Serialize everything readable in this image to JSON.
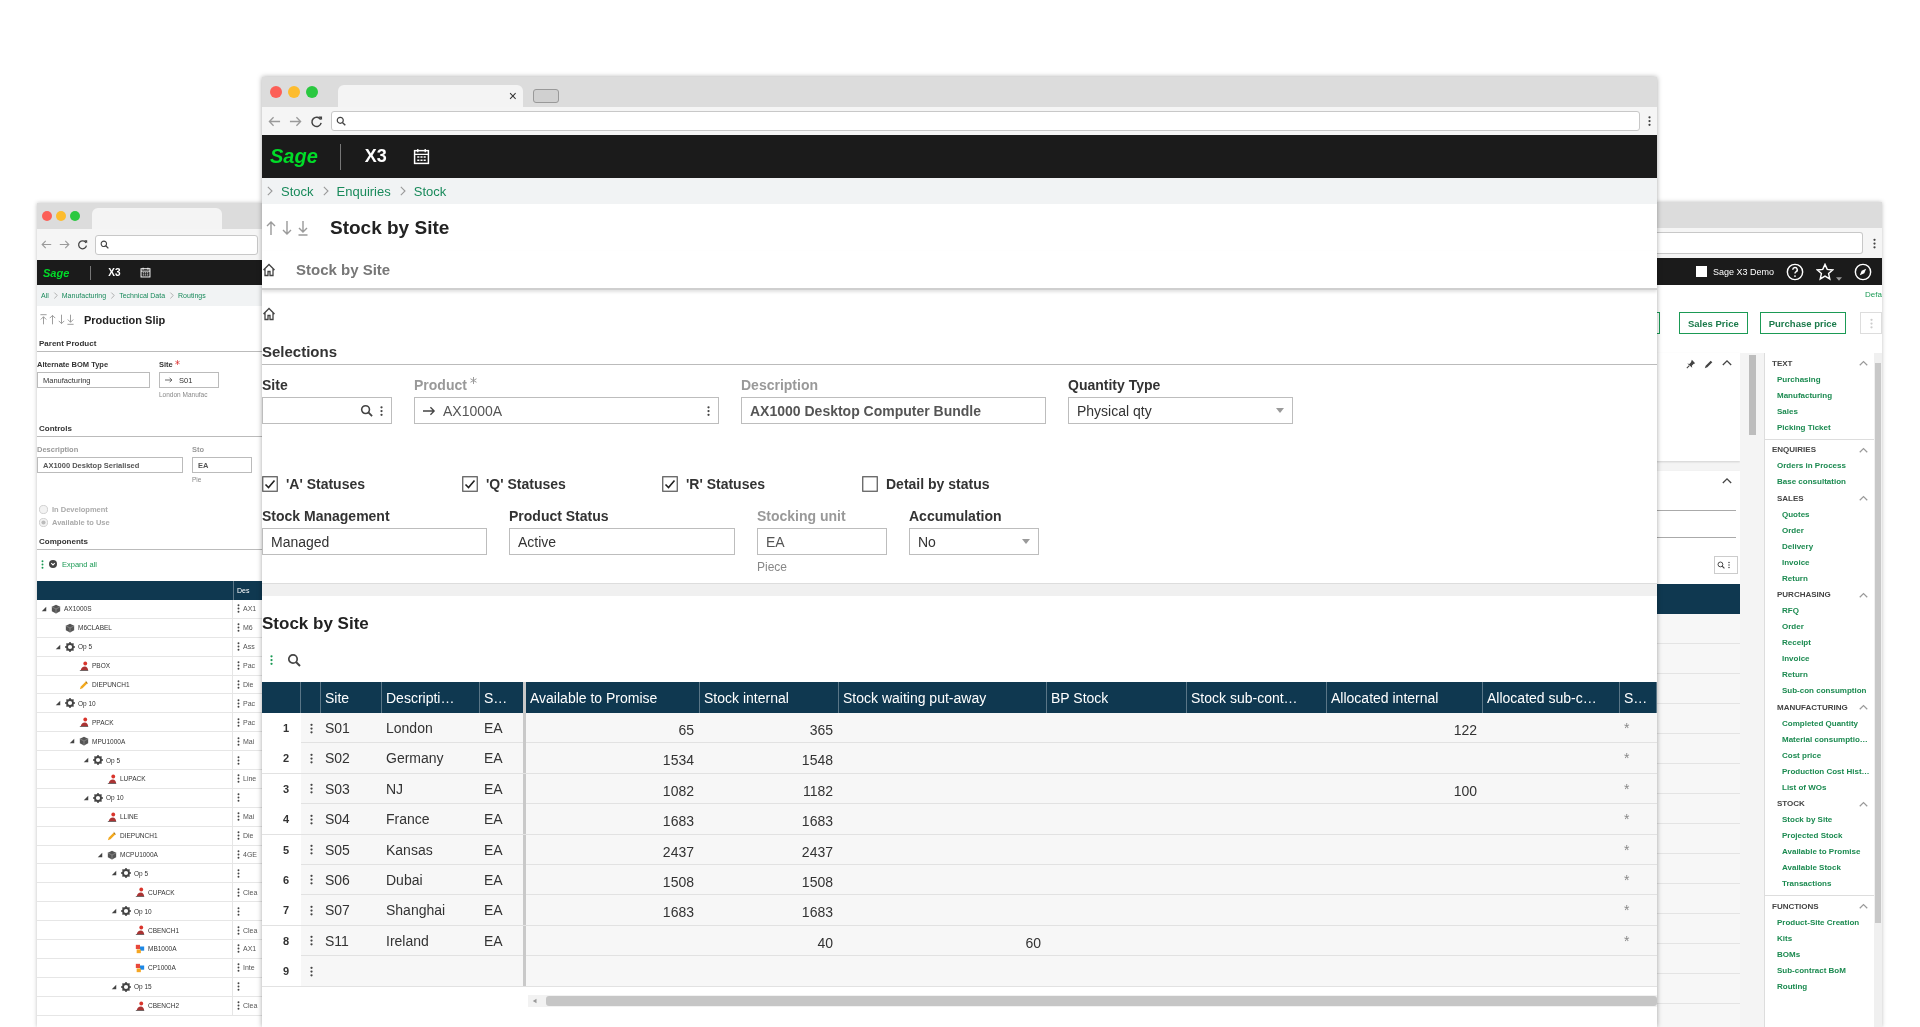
{
  "main": {
    "tab_close": "×",
    "header": {
      "logo": "Sage",
      "app": "X3"
    },
    "breadcrumb": [
      "Stock",
      "Enquiries",
      "Stock"
    ],
    "title": "Stock by Site",
    "page_tab": "Stock by Site",
    "section": "Selections",
    "fields": [
      {
        "kind": "lookup",
        "label": "Site",
        "disabled": false
      },
      {
        "kind": "link",
        "label": "Product",
        "required": true,
        "disabled": true,
        "value": "AX1000A"
      },
      {
        "kind": "text",
        "label": "Description",
        "disabled": true,
        "value": "AX1000 Desktop Computer Bundle"
      },
      {
        "kind": "select",
        "label": "Quantity Type",
        "disabled": false,
        "value": "Physical qty"
      }
    ],
    "checkboxes": [
      {
        "label": "'A' Statuses",
        "checked": true
      },
      {
        "label": "'Q' Statuses",
        "checked": true
      },
      {
        "label": "'R' Statuses",
        "checked": true
      },
      {
        "label": "Detail by status",
        "checked": false
      }
    ],
    "fields2": [
      {
        "kind": "text",
        "label": "Stock Management",
        "disabled": false,
        "value": "Managed"
      },
      {
        "kind": "text",
        "label": "Product Status",
        "disabled": false,
        "value": "Active"
      },
      {
        "kind": "text",
        "label": "Stocking unit",
        "disabled": true,
        "value": "EA",
        "hint": "Piece"
      },
      {
        "kind": "select",
        "label": "Accumulation",
        "disabled": false,
        "value": "No"
      }
    ],
    "grid": {
      "title": "Stock by Site",
      "columns": [
        "Site",
        "Descripti…",
        "S…",
        "Available to Promise",
        "Stock internal",
        "Stock waiting put-away",
        "BP Stock",
        "Stock sub-cont…",
        "Allocated internal",
        "Allocated sub-c…",
        "S…"
      ],
      "rows": [
        {
          "number": "1",
          "cells": [
            "S01",
            "London",
            "EA",
            "65",
            "365",
            null,
            null,
            null,
            "122",
            null,
            "*"
          ]
        },
        {
          "number": "2",
          "cells": [
            "S02",
            "Germany",
            "EA",
            "1534",
            "1548",
            null,
            null,
            null,
            null,
            null,
            "*"
          ]
        },
        {
          "number": "3",
          "cells": [
            "S03",
            "NJ",
            "EA",
            "1082",
            "1182",
            null,
            null,
            null,
            "100",
            null,
            "*"
          ]
        },
        {
          "number": "4",
          "cells": [
            "S04",
            "France",
            "EA",
            "1683",
            "1683",
            null,
            null,
            null,
            null,
            null,
            "*"
          ]
        },
        {
          "number": "5",
          "cells": [
            "S05",
            "Kansas",
            "EA",
            "2437",
            "2437",
            null,
            null,
            null,
            null,
            null,
            "*"
          ]
        },
        {
          "number": "6",
          "cells": [
            "S06",
            "Dubai",
            "EA",
            "1508",
            "1508",
            null,
            null,
            null,
            null,
            null,
            "*"
          ]
        },
        {
          "number": "7",
          "cells": [
            "S07",
            "Shanghai",
            "EA",
            "1683",
            "1683",
            null,
            null,
            null,
            null,
            null,
            "*"
          ]
        },
        {
          "number": "8",
          "cells": [
            "S11",
            "Ireland",
            "EA",
            null,
            "40",
            "60",
            null,
            null,
            null,
            null,
            "*"
          ]
        },
        {
          "number": "9"
        }
      ]
    }
  },
  "left": {
    "header": {
      "logo": "Sage",
      "app": "X3"
    },
    "breadcrumb": [
      "All",
      "Manufacturing",
      "Technical Data",
      "Routings"
    ],
    "title": "Production Slip",
    "section": "Parent Product",
    "bom_type": {
      "label": "Alternate BOM Type",
      "value": "Manufacturing"
    },
    "site": {
      "label": "Site",
      "required": true,
      "value": "S01",
      "hint": "London Manufac"
    },
    "controls_title": "Controls",
    "description": {
      "label": "Description",
      "value": "AX1000 Desktop Serialised"
    },
    "cut_field": {
      "label": "Sto",
      "value": "EA",
      "hint": "Pie"
    },
    "radios": [
      {
        "label": "In Development",
        "selected": false
      },
      {
        "label": "Available to Use",
        "selected": true
      }
    ],
    "components_title": "Components",
    "expand_all": "Expand all",
    "column": "Des",
    "tree": [
      {
        "label": "AX1000S",
        "kind": "product",
        "desc": "AX1",
        "expanded": true,
        "children": [
          {
            "label": "M6CLABEL",
            "kind": "product",
            "desc": "M6"
          },
          {
            "label": "Op 5",
            "kind": "operation",
            "desc": "Ass",
            "expanded": true,
            "children": [
              {
                "label": "PBOX",
                "kind": "resource",
                "desc": "Pac"
              },
              {
                "label": "DIEPUNCH1",
                "kind": "tool",
                "desc": "Die"
              }
            ]
          },
          {
            "label": "Op 10",
            "kind": "operation",
            "desc": "Pac",
            "expanded": true,
            "children": [
              {
                "label": "PPACK",
                "kind": "resource",
                "desc": "Pac"
              },
              {
                "label": "MPU1000A",
                "kind": "product",
                "desc": "Mai",
                "expanded": true,
                "children": [
                  {
                    "label": "Op 5",
                    "kind": "operation",
                    "expanded": true,
                    "children": [
                      {
                        "label": "LUPACK",
                        "kind": "resource",
                        "desc": "Line"
                      }
                    ]
                  },
                  {
                    "label": "Op 10",
                    "kind": "operation",
                    "expanded": true,
                    "children": [
                      {
                        "label": "LLINE",
                        "kind": "resource",
                        "desc": "Mai"
                      },
                      {
                        "label": "DIEPUNCH1",
                        "kind": "tool",
                        "desc": "Die"
                      },
                      {
                        "label": "MCPU1000A",
                        "kind": "product",
                        "desc": "4GE",
                        "expanded": true,
                        "children": [
                          {
                            "label": "Op 5",
                            "kind": "operation",
                            "expanded": true,
                            "children": [
                              {
                                "label": "CUPACK",
                                "kind": "resource",
                                "desc": "Clea"
                              }
                            ]
                          },
                          {
                            "label": "Op 10",
                            "kind": "operation",
                            "expanded": true,
                            "children": [
                              {
                                "label": "CBENCH1",
                                "kind": "resource",
                                "desc": "Clea"
                              },
                              {
                                "label": "MB1000A",
                                "kind": "part",
                                "desc": "AX1"
                              },
                              {
                                "label": "CP1000A",
                                "kind": "part",
                                "desc": "Inte"
                              }
                            ]
                          },
                          {
                            "label": "Op 15",
                            "kind": "operation",
                            "expanded": true,
                            "children": [
                              {
                                "label": "CBENCH2",
                                "kind": "resource",
                                "desc": "Clea"
                              }
                            ]
                          }
                        ]
                      }
                    ]
                  }
                ]
              }
            ]
          }
        ]
      }
    ]
  },
  "right": {
    "account": "Sage X3 Demo",
    "cut_link": "Defa",
    "buttons": [
      "Sales Price",
      "Purchase price"
    ],
    "sidebar": [
      {
        "title": "TEXT",
        "expanded": true,
        "items": [
          "Purchasing",
          "Manufacturing",
          "Sales",
          "Picking Ticket"
        ]
      },
      {
        "title": "ENQUIRIES",
        "expanded": true,
        "items": [
          "Orders in Process",
          "Base consultation"
        ],
        "groups": [
          {
            "title": "SALES",
            "expanded": true,
            "items": [
              "Quotes",
              "Order",
              "Delivery",
              "Invoice",
              "Return"
            ]
          },
          {
            "title": "PURCHASING",
            "expanded": true,
            "items": [
              "RFQ",
              "Order",
              "Receipt",
              "Invoice",
              "Return",
              "Sub-con consumption"
            ]
          },
          {
            "title": "MANUFACTURING",
            "expanded": true,
            "items": [
              "Completed Quantity",
              "Material consumptio…",
              "Cost price",
              "Production Cost Hist…",
              "List of WOs"
            ]
          },
          {
            "title": "STOCK",
            "expanded": true,
            "items": [
              "Stock by Site",
              "Projected Stock",
              "Available to Promise",
              "Available Stock",
              "Transactions"
            ]
          }
        ]
      },
      {
        "title": "FUNCTIONS",
        "expanded": true,
        "items": [
          "Product-Site Creation",
          "Kits",
          "BOMs",
          "Sub-contract BoM",
          "Routing"
        ]
      }
    ]
  }
}
